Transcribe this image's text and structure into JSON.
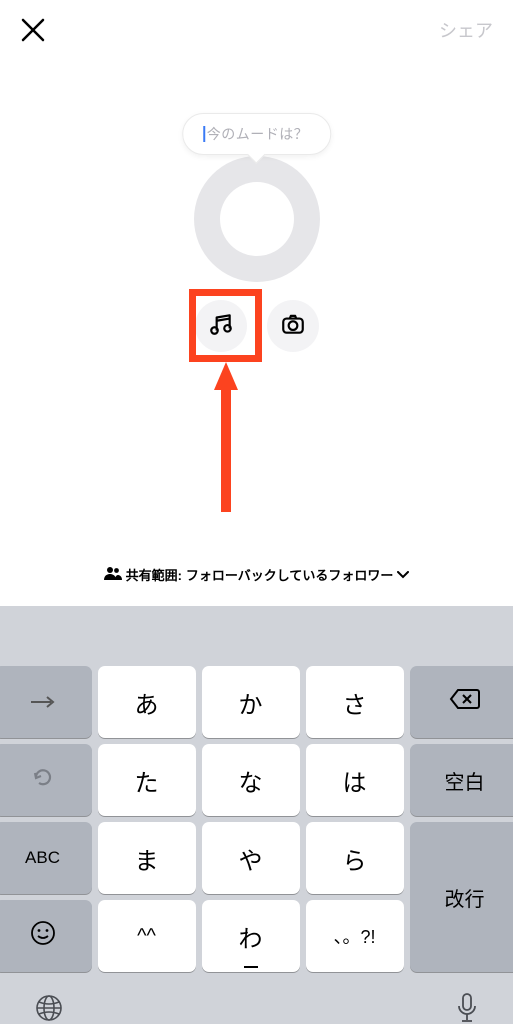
{
  "topbar": {
    "share_label": "シェア"
  },
  "mood_prompt": {
    "placeholder": "今のムードは？"
  },
  "audience": {
    "label": "共有範囲:",
    "value": "フォローバックしているフォロワー"
  },
  "annotation": {
    "highlight_target": "music-button",
    "color": "#fc431f"
  },
  "keyboard": {
    "rows": [
      {
        "arrow": "→",
        "k1": "あ",
        "k2": "か",
        "k3": "さ",
        "right": "delete"
      },
      {
        "undo": "↺",
        "k1": "た",
        "k2": "な",
        "k3": "は",
        "right": "空白"
      },
      {
        "abc": "ABC",
        "k1": "ま",
        "k2": "や",
        "k3": "ら",
        "right": "改行"
      },
      {
        "emoji": "☺",
        "k1": "^^",
        "k2": "わ",
        "k3": "、。?!",
        "right": ""
      }
    ],
    "space_label": "空白",
    "return_label": "改行",
    "abc_label": "ABC"
  }
}
